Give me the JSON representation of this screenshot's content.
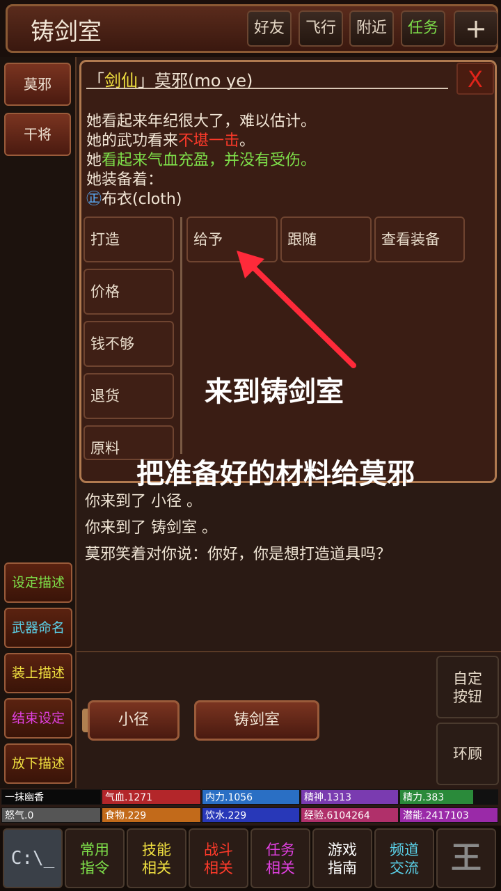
{
  "header": {
    "title": "铸剑室",
    "buttons": [
      "好友",
      "飞行",
      "附近",
      "任务"
    ],
    "plus": "+"
  },
  "npcs": [
    "莫邪",
    "干将"
  ],
  "dialog": {
    "name": "「剑仙」莫邪(mo ye)",
    "close": "X",
    "line1": "她看起来年纪很大了，难以估计。",
    "line2a": "她的武功看来",
    "line2b": "不堪一击",
    "line2c": "。",
    "line3a": "她",
    "line3b": "看起来气血充盈，并没有受伤。",
    "line4": "她装备着：",
    "equip_mark": "㊣",
    "equip": "布衣(cloth)",
    "left_commands": [
      "打造",
      "价格",
      "钱不够",
      "退货",
      "原料"
    ],
    "actions": [
      "给予",
      "跟随",
      "查看装备"
    ]
  },
  "annotations": {
    "arrive": "来到铸剑室",
    "give": "把准备好的材料给莫邪"
  },
  "messages": [
    "你来到了 小径 。",
    "你来到了 铸剑室 。",
    "莫邪笑着对你说：你好，你是想打造道具吗？"
  ],
  "settings": [
    {
      "label": "设定描述",
      "color": "#7ee04a"
    },
    {
      "label": "武器命名",
      "color": "#5ad0e8"
    },
    {
      "label": "装上描述",
      "color": "#f0e040"
    },
    {
      "label": "结束设定",
      "color": "#e040e0"
    },
    {
      "label": "放下描述",
      "color": "#f0e040"
    }
  ],
  "exits": [
    "小径",
    "铸剑室"
  ],
  "right_buttons": {
    "custom": "自定\n按钮",
    "look": "环顾"
  },
  "stats": {
    "player": "一抹幽香",
    "qixue": "气血.1271",
    "neili": "内力.1056",
    "jingshen": "精神.1313",
    "jingli": "精力.383",
    "nuqi": "怒气.0",
    "shiwu": "食物.229",
    "yinshui": "饮水.229",
    "jingyan": "经验.6104264",
    "qianneng": "潜能.2417103",
    "colors": {
      "qixue": "#b3262a",
      "neili": "#2a6fc4",
      "jingshen": "#7a3bb0",
      "jingli": "#2a8a3a",
      "nuqi": "#555555",
      "shiwu": "#c26a1a",
      "yinshui": "#2838b8",
      "jingyan": "#b0306a",
      "qianneng": "#9a2aa8"
    },
    "jingli_fill": 0.75
  },
  "nav": {
    "console": "C:\\_",
    "items": [
      {
        "l1": "常用",
        "l2": "指令",
        "color": "#7ee04a"
      },
      {
        "l1": "技能",
        "l2": "相关",
        "color": "#f0e040"
      },
      {
        "l1": "战斗",
        "l2": "相关",
        "color": "#ff3a2a"
      },
      {
        "l1": "任务",
        "l2": "相关",
        "color": "#e040e0"
      },
      {
        "l1": "游戏",
        "l2": "指南",
        "color": "#ffffff"
      },
      {
        "l1": "频道",
        "l2": "交流",
        "color": "#5ad0e8"
      }
    ],
    "logo": "王"
  }
}
